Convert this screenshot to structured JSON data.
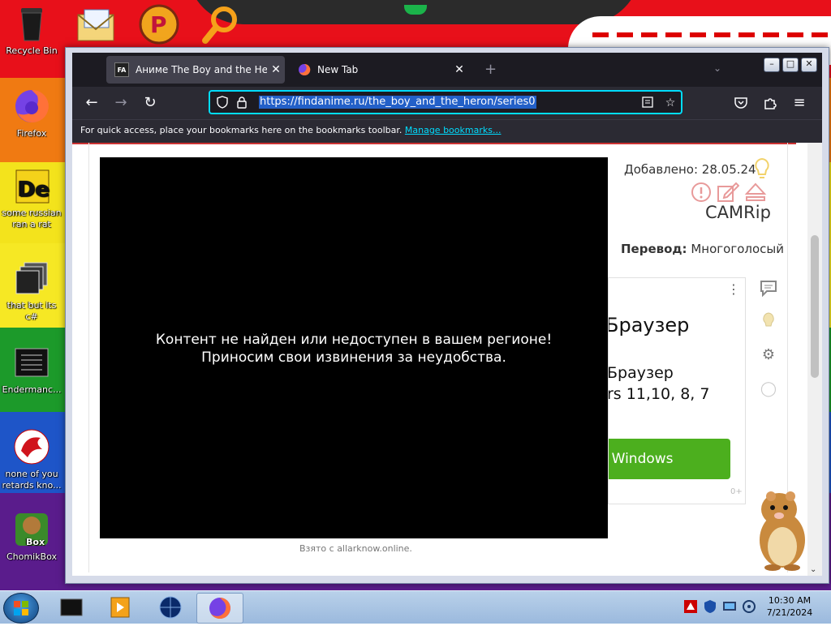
{
  "desktop": {
    "icons": [
      {
        "label": "Recycle Bin",
        "icon": "recycle-bin-icon"
      },
      {
        "label": "Firefox",
        "icon": "firefox-icon"
      },
      {
        "label": "some russian ran a rat",
        "icon": "de-app-icon"
      },
      {
        "label": "that but its c#",
        "icon": "windows-stack-icon"
      },
      {
        "label": "Endermanc...",
        "icon": "terminal-icon"
      },
      {
        "label": "none of you retards kno...",
        "icon": "red-dragon-icon"
      },
      {
        "label": "ChomikBox",
        "icon": "chomikbox-icon"
      }
    ],
    "top_icons": [
      "mail-icon",
      "p-app-icon",
      "magnifier-icon"
    ]
  },
  "browser": {
    "tabs": [
      {
        "label": "Аниме The Boy and the Heron",
        "favicon": "FA"
      },
      {
        "label": "New Tab"
      }
    ],
    "url": "https://findanime.ru/the_boy_and_the_heron/series0",
    "bookmarks_text": "For quick access, place your bookmarks here on the bookmarks toolbar.",
    "bookmarks_link": "Manage bookmarks..."
  },
  "page": {
    "player_line1": "Контент не найден или недоступен в вашем регионе!",
    "player_line2": "Приносим свои извинения за неудобства.",
    "source": "Взято с allarknow.online.",
    "added": "Добавлено: 28.05.24",
    "quality": "CAMRip",
    "translation_label": "Перевод:",
    "translation_value": " Многоголосый",
    "ad_title": "Браузер",
    "ad_sub1": "Браузер",
    "ad_sub2": "rs 11,10, 8, 7",
    "ad_button": "я Windows",
    "ad_mark": "0+"
  },
  "taskbar": {
    "time": "10:30 AM",
    "date": "7/21/2024"
  },
  "colors": {
    "accent": "#00ddff",
    "ad_button": "#4caf1e",
    "tab_bg": "#1c1b22"
  }
}
